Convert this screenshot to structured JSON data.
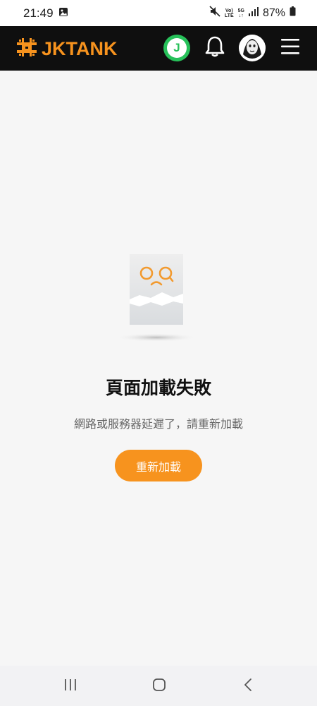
{
  "status_bar": {
    "time": "21:49",
    "volte_top": "Vo)",
    "volte_bottom": "LTE",
    "network": "5G",
    "battery": "87%"
  },
  "header": {
    "logo_text": "JKTANK",
    "j_label": "J",
    "brand_color": "#f7931e",
    "icons": [
      "j-badge-icon",
      "bell-icon",
      "avatar",
      "hamburger-menu-icon"
    ]
  },
  "error": {
    "title": "頁面加載失敗",
    "message": "網路或服務器延遲了，請重新加載",
    "reload_label": "重新加載"
  },
  "nav": {
    "icons": [
      "recent-apps-icon",
      "home-icon",
      "back-icon"
    ]
  }
}
